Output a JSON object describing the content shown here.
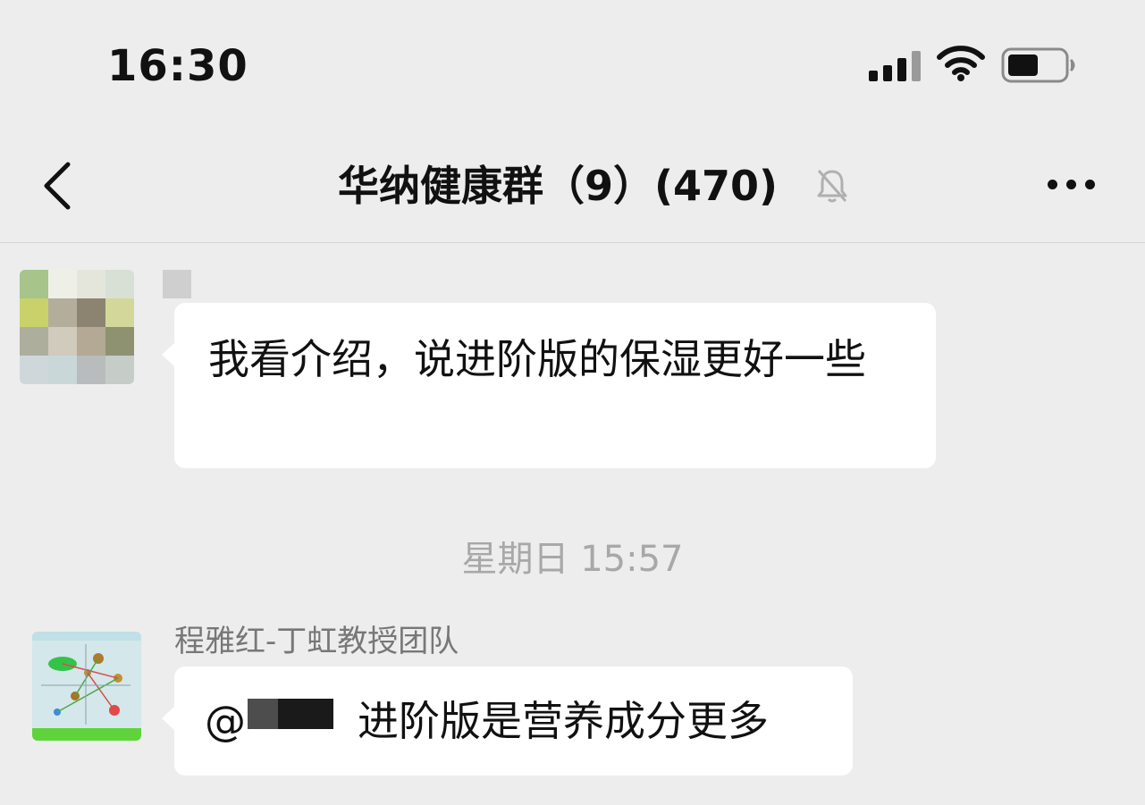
{
  "status_bar": {
    "time": "16:30",
    "signal_icon": "cellular-signal-icon",
    "wifi_icon": "wifi-icon",
    "battery_icon": "battery-icon",
    "battery_level": 0.55
  },
  "nav": {
    "back_icon": "chevron-left-icon",
    "title": "华纳健康群（9）(470)",
    "mute_icon": "bell-slash-icon",
    "more_icon": "ellipsis-icon"
  },
  "messages": [
    {
      "avatar": "pixelated-avatar",
      "sender": "",
      "text": "我看介绍，说进阶版的保湿更好一些"
    },
    {
      "avatar": "circuit-diagram-avatar",
      "sender": "程雅红-丁虹教授团队",
      "mention_symbol": "@",
      "text": "进阶版是营养成分更多"
    }
  ],
  "timestamp": "星期日 15:57",
  "colors": {
    "background": "#ededed",
    "bubble": "#ffffff",
    "timestamp": "#a8a8a8",
    "sender_name": "#777777"
  }
}
